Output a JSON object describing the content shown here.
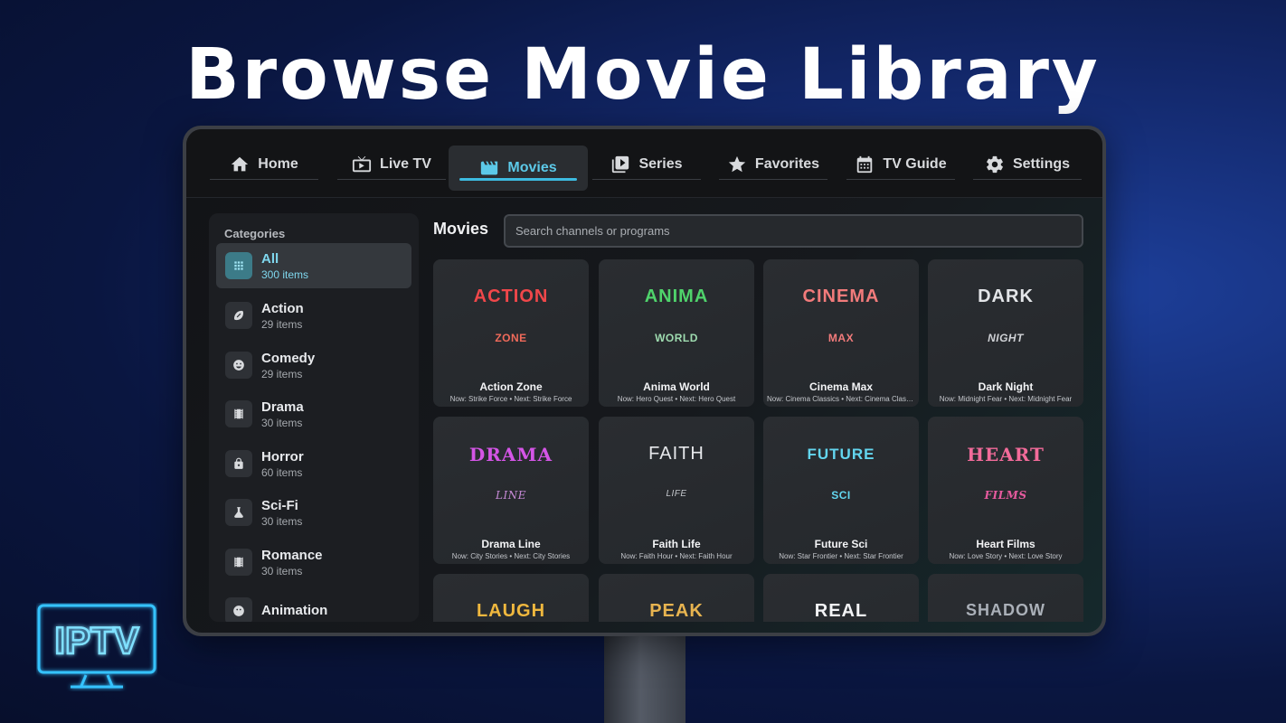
{
  "headline": "Browse Movie Library",
  "brand": {
    "logo_text": "IPTV",
    "accent_color": "#3dbbe0"
  },
  "nav": [
    {
      "label": "Home",
      "icon": "home-icon"
    },
    {
      "label": "Live TV",
      "icon": "tv-icon"
    },
    {
      "label": "Movies",
      "icon": "clapperboard-icon",
      "active": true
    },
    {
      "label": "Series",
      "icon": "play-library-icon"
    },
    {
      "label": "Favorites",
      "icon": "star-icon"
    },
    {
      "label": "TV Guide",
      "icon": "calendar-icon"
    },
    {
      "label": "Settings",
      "icon": "gear-icon"
    }
  ],
  "sidebar": {
    "title": "Categories",
    "items": [
      {
        "name": "All",
        "count": "300 items",
        "icon": "grid-icon",
        "active": true
      },
      {
        "name": "Action",
        "count": "29 items",
        "icon": "football-icon"
      },
      {
        "name": "Comedy",
        "count": "29 items",
        "icon": "smiley-icon"
      },
      {
        "name": "Drama",
        "count": "30 items",
        "icon": "film-strip-icon"
      },
      {
        "name": "Horror",
        "count": "60 items",
        "icon": "lock-icon"
      },
      {
        "name": "Sci-Fi",
        "count": "30 items",
        "icon": "flask-icon"
      },
      {
        "name": "Romance",
        "count": "30 items",
        "icon": "film-strip-icon"
      },
      {
        "name": "Animation",
        "count": "",
        "icon": "face-icon"
      }
    ]
  },
  "main": {
    "title": "Movies",
    "search_placeholder": "Search channels or programs"
  },
  "cards": [
    {
      "logo_main": "ACTION",
      "logo_sub": "ZONE",
      "title": "Action Zone",
      "subtitle": "Now: Strike Force • Next: Strike Force",
      "color_main": "#f0474a",
      "color_sub": "#f06a5a"
    },
    {
      "logo_main": "ANIMA",
      "logo_sub": "WORLD",
      "title": "Anima World",
      "subtitle": "Now: Hero Quest • Next: Hero Quest",
      "color_main": "#4fd36b",
      "color_sub": "#9fdcb0"
    },
    {
      "logo_main": "CINEMA",
      "logo_sub": "MAX",
      "title": "Cinema Max",
      "subtitle": "Now: Cinema Classics • Next: Cinema Classics",
      "color_main": "#f27b7b",
      "color_sub": "#f27b7b"
    },
    {
      "logo_main": "DARK",
      "logo_sub": "NIGHT",
      "title": "Dark Night",
      "subtitle": "Now: Midnight Fear • Next: Midnight Fear",
      "color_main": "#e3e5e8",
      "color_sub": "#d0d2d6"
    },
    {
      "logo_main": "DRAMA",
      "logo_sub": "LINE",
      "title": "Drama Line",
      "subtitle": "Now: City Stories • Next: City Stories",
      "color_main": "#d455e6",
      "color_sub": "#c78ad6"
    },
    {
      "logo_main": "FAITH",
      "logo_sub": "LIFE",
      "title": "Faith Life",
      "subtitle": "Now: Faith Hour • Next: Faith Hour",
      "color_main": "#e6e8eb",
      "color_sub": "#c3c6cb"
    },
    {
      "logo_main": "FUTURE",
      "logo_sub": "SCI",
      "title": "Future Sci",
      "subtitle": "Now: Star Frontier • Next: Star Frontier",
      "color_main": "#63d6ef",
      "color_sub": "#63d6ef"
    },
    {
      "logo_main": "HEART",
      "logo_sub": "FILMS",
      "title": "Heart Films",
      "subtitle": "Now: Love Story • Next: Love Story",
      "color_main": "#f26b9a",
      "color_sub": "#e65a9e"
    },
    {
      "logo_main": "LAUGH",
      "logo_sub": "",
      "title": "",
      "subtitle": "",
      "color_main": "#f0b83e",
      "color_sub": "#f0b83e"
    },
    {
      "logo_main": "PEAK",
      "logo_sub": "",
      "title": "",
      "subtitle": "",
      "color_main": "#e8b450",
      "color_sub": "#e8b450"
    },
    {
      "logo_main": "REAL",
      "logo_sub": "",
      "title": "",
      "subtitle": "",
      "color_main": "#f3f4f6",
      "color_sub": "#f3f4f6"
    },
    {
      "logo_main": "SHADOW",
      "logo_sub": "",
      "title": "",
      "subtitle": "",
      "color_main": "#aab0b8",
      "color_sub": "#aab0b8"
    }
  ]
}
